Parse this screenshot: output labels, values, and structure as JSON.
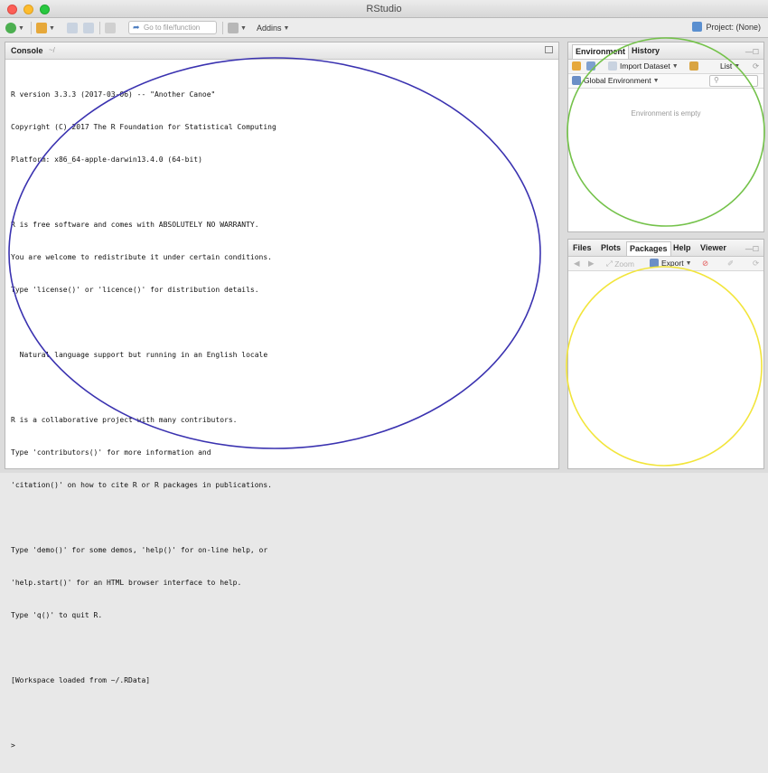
{
  "window": {
    "title": "RStudio"
  },
  "toolbar": {
    "goto_placeholder": "Go to file/function",
    "addins_label": "Addins",
    "project_label": "Project: (None)"
  },
  "console": {
    "title": "Console",
    "path": "~/",
    "lines": [
      "R version 3.3.3 (2017-03-06) -- \"Another Canoe\"",
      "Copyright (C) 2017 The R Foundation for Statistical Computing",
      "Platform: x86_64-apple-darwin13.4.0 (64-bit)",
      "",
      "R is free software and comes with ABSOLUTELY NO WARRANTY.",
      "You are welcome to redistribute it under certain conditions.",
      "Type 'license()' or 'licence()' for distribution details.",
      "",
      "  Natural language support but running in an English locale",
      "",
      "R is a collaborative project with many contributors.",
      "Type 'contributors()' for more information and",
      "'citation()' on how to cite R or R packages in publications.",
      "",
      "Type 'demo()' for some demos, 'help()' for on-line help, or",
      "'help.start()' for an HTML browser interface to help.",
      "Type 'q()' to quit R.",
      "",
      "[Workspace loaded from ~/.RData]",
      "",
      ">"
    ]
  },
  "env_pane": {
    "tabs": [
      "Environment",
      "History"
    ],
    "import_dataset_label": "Import Dataset",
    "list_label": "List",
    "global_env_label": "Global Environment",
    "empty_message": "Environment is empty"
  },
  "files_pane": {
    "tabs": [
      "Files",
      "Plots",
      "Packages",
      "Help",
      "Viewer"
    ],
    "zoom_label": "Zoom",
    "export_label": "Export"
  },
  "annotations": {
    "console_circle_color": "#3a32b0",
    "env_circle_color": "#74c24a",
    "files_circle_color": "#f2e53a"
  },
  "icons": [
    "new-file-icon",
    "open-project-icon",
    "save-icon",
    "save-all-icon",
    "print-icon",
    "goto-arrow-icon",
    "grid-icon",
    "project-icon",
    "broom-icon",
    "refresh-icon",
    "search-icon",
    "back-icon",
    "forward-icon",
    "zoom-icon",
    "export-icon",
    "remove-plot-icon"
  ]
}
